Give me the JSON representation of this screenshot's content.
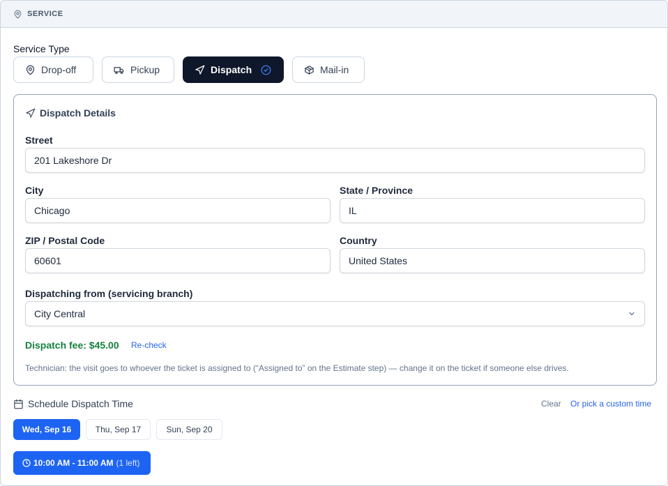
{
  "header": {
    "title": "SERVICE",
    "icon": "map-pin-icon"
  },
  "service_type": {
    "label": "Service Type",
    "options": [
      {
        "label": "Drop-off",
        "icon": "map-pin-icon",
        "selected": false
      },
      {
        "label": "Pickup",
        "icon": "truck-icon",
        "selected": false
      },
      {
        "label": "Dispatch",
        "icon": "navigation-icon",
        "selected": true
      },
      {
        "label": "Mail-in",
        "icon": "package-icon",
        "selected": false
      }
    ]
  },
  "dispatch": {
    "title": "Dispatch Details",
    "street": {
      "label": "Street",
      "value": "201 Lakeshore Dr"
    },
    "city": {
      "label": "City",
      "value": "Chicago"
    },
    "state": {
      "label": "State / Province",
      "value": "IL"
    },
    "zip": {
      "label": "ZIP / Postal Code",
      "value": "60601"
    },
    "country": {
      "label": "Country",
      "value": "United States"
    },
    "branch": {
      "label": "Dispatching from (servicing branch)",
      "value": "City Central"
    },
    "fee": "Dispatch fee: $45.00",
    "recheck": "Re-check",
    "note": "Technician: the visit goes to whoever the ticket is assigned to (“Assigned to” on the Estimate step) — change it on the ticket if someone else drives."
  },
  "schedule": {
    "title": "Schedule Dispatch Time",
    "clear": "Clear",
    "custom": "Or pick a custom time",
    "dates": [
      {
        "label": "Wed, Sep 16",
        "selected": true
      },
      {
        "label": "Thu, Sep 17",
        "selected": false
      },
      {
        "label": "Sun, Sep 20",
        "selected": false
      }
    ],
    "slot": {
      "time": "10:00 AM - 11:00 AM",
      "availability": "(1 left)"
    }
  },
  "colors": {
    "accent": "#1d64f2",
    "dark": "#0f172a",
    "fee_green": "#15803d",
    "link": "#2563eb"
  }
}
